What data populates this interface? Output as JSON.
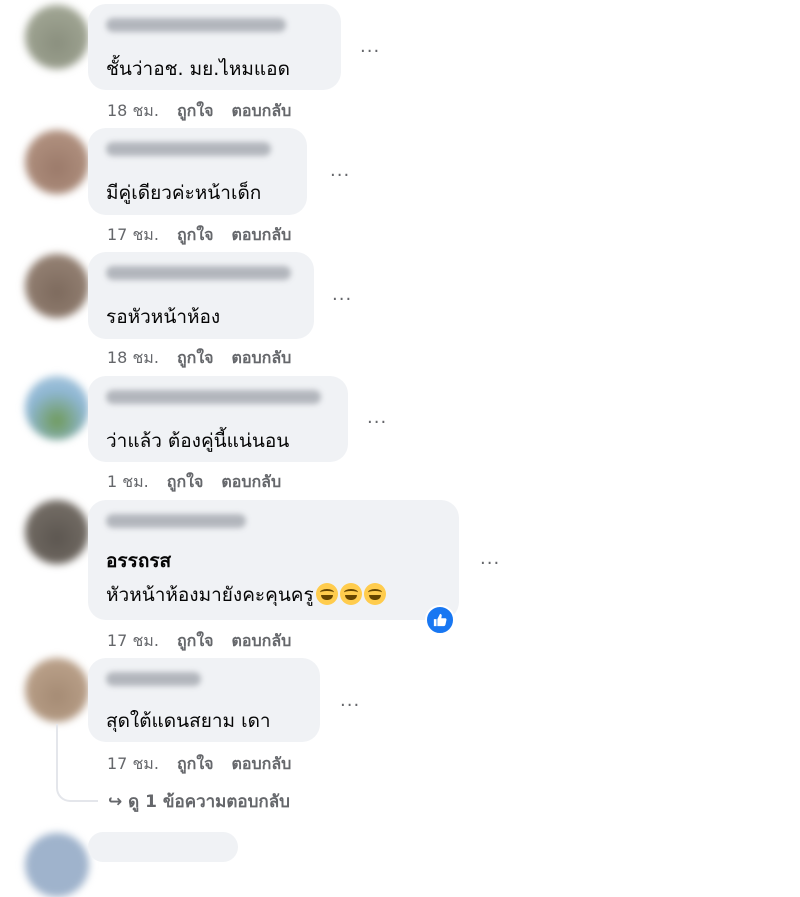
{
  "comments": [
    {
      "text": "ชั้นว่าอช. มย.ไหมแอด",
      "time": "18 ชม.",
      "like": "ถูกใจ",
      "reply": "ตอบกลับ"
    },
    {
      "text": "มีคู่เดียวค่ะหน้าเด็ก",
      "time": "17 ชม.",
      "like": "ถูกใจ",
      "reply": "ตอบกลับ"
    },
    {
      "text": "รอหัวหน้าห้อง",
      "time": "18 ชม.",
      "like": "ถูกใจ",
      "reply": "ตอบกลับ"
    },
    {
      "text": "ว่าแล้ว ต้องคู่นี้แน่นอน",
      "time": "1 ชม.",
      "like": "ถูกใจ",
      "reply": "ตอบกลับ"
    },
    {
      "mention": "อรรถรส",
      "text": "หัวหน้าห้องมายังคะคุนครู",
      "time": "17 ชม.",
      "like": "ถูกใจ",
      "reply": "ตอบกลับ",
      "emoji": "grinning-sweat-emoji"
    },
    {
      "text": "สุดใต้แดนสยาม เดา",
      "time": "17 ชม.",
      "like": "ถูกใจ",
      "reply": "ตอบกลับ"
    }
  ],
  "more_label": "...",
  "view_replies": "↪ ดู 1 ข้อความตอบกลับ",
  "colors": {
    "bubble": "#f0f2f5",
    "meta": "#65676b",
    "like_blue": "#1877f2",
    "text": "#050505"
  }
}
